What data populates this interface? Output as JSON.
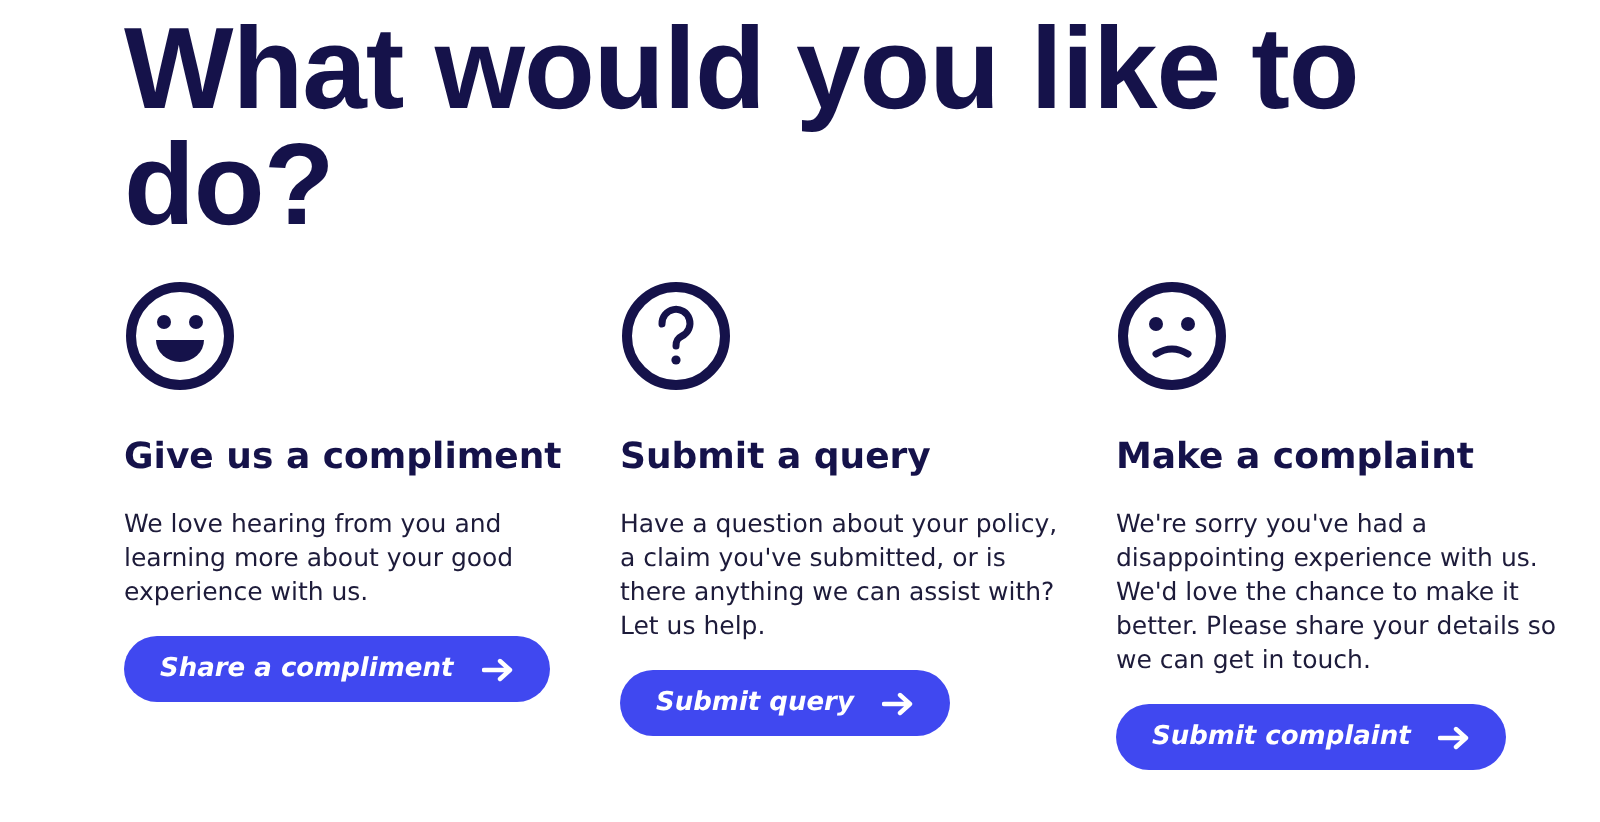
{
  "heading": "What would you like to do?",
  "options": [
    {
      "kind": "happy",
      "title": "Give us a compliment",
      "text": "We love hearing from you and learning more about your good experience with us.",
      "button": "Share a compliment"
    },
    {
      "kind": "question",
      "title": "Submit a query",
      "text": "Have a question about your policy, a claim you've submitted, or is there anything we can assist with? Let us help.",
      "button": "Submit query"
    },
    {
      "kind": "sad",
      "title": "Make a complaint",
      "text": "We're sorry you've had a disappointing experience with us. We'd love the chance to make it better. Please share your details so we can get in touch.",
      "button": "Submit complaint"
    }
  ]
}
